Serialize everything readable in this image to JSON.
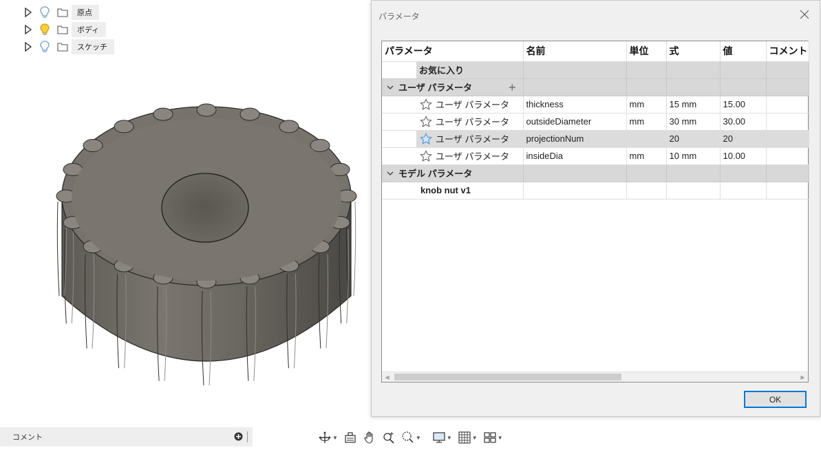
{
  "browser": {
    "items": [
      {
        "label": "原点",
        "bulb_color": "#9cc3e5"
      },
      {
        "label": "ボディ",
        "bulb_color": "#f2c230"
      },
      {
        "label": "スケッチ",
        "bulb_color": "#9cc3e5"
      }
    ]
  },
  "dialog": {
    "title": "パラメータ",
    "ok_label": "OK",
    "columns": [
      "パラメータ",
      "名前",
      "単位",
      "式",
      "値",
      "コメント"
    ],
    "favorites_label": "お気に入り",
    "user_group_label": "ユーザ パラメータ",
    "user_params": [
      {
        "type": "ユーザ パラメータ",
        "name": "thickness",
        "unit": "mm",
        "expression": "15 mm",
        "value": "15.00",
        "comment": "",
        "highlighted": false
      },
      {
        "type": "ユーザ パラメータ",
        "name": "outsideDiameter",
        "unit": "mm",
        "expression": "30 mm",
        "value": "30.00",
        "comment": "",
        "highlighted": false
      },
      {
        "type": "ユーザ パラメータ",
        "name": "projectionNum",
        "unit": "",
        "expression": "20",
        "value": "20",
        "comment": "",
        "highlighted": true
      },
      {
        "type": "ユーザ パラメータ",
        "name": "insideDia",
        "unit": "mm",
        "expression": "10 mm",
        "value": "10.00",
        "comment": "",
        "highlighted": false
      }
    ],
    "model_group_label": "モデル パラメータ",
    "model_item_label": "knob nut v1"
  },
  "comments": {
    "label": "コメント"
  },
  "toolbar": {
    "icons": [
      "orbit-icon",
      "look-at-icon",
      "pan-icon",
      "zoom-icon",
      "fit-icon",
      "display-settings-icon",
      "grid-settings-icon",
      "viewports-icon"
    ]
  },
  "colors": {
    "accent": "#0078d7",
    "group_row": "#d8d8d8",
    "star_active": "#4a90d9"
  }
}
